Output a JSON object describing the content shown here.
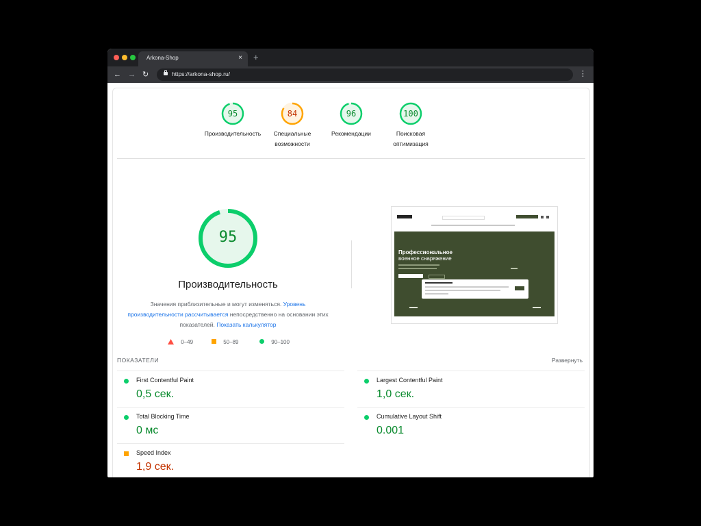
{
  "browser": {
    "tab_title": "Arkona-Shop",
    "tab_close": "×",
    "new_tab": "+",
    "url": "https://arkona-shop.ru/",
    "back": "←",
    "forward": "→",
    "reload": "↻",
    "menu": "⋮"
  },
  "scores": [
    {
      "value": "95",
      "label": "Производительность",
      "status": "good",
      "fraction": 0.95
    },
    {
      "value": "84",
      "label": "Специальные возможности",
      "status": "average",
      "fraction": 0.84
    },
    {
      "value": "96",
      "label": "Рекомендации",
      "status": "good",
      "fraction": 0.96
    },
    {
      "value": "100",
      "label": "Поисковая оптимизация",
      "status": "good",
      "fraction": 1.0
    }
  ],
  "performance": {
    "score": "95",
    "fraction": 0.95,
    "title": "Производительность",
    "desc_1": "Значения приблизительные и могут изменяться. ",
    "desc_link_1": "Уровень производительности рассчитывается",
    "desc_2": " непосредственно на основании этих показателей. ",
    "desc_link_2": "Показать калькулятор"
  },
  "legend": {
    "bad": "0–49",
    "average": "50–89",
    "good": "90–100"
  },
  "screenshot": {
    "hero_line1": "Профессиональное",
    "hero_line2": "военное снаряжение"
  },
  "metrics_section": {
    "header": "ПОКАЗАТЕЛИ",
    "expand": "Развернуть"
  },
  "metrics": [
    {
      "name": "First Contentful Paint",
      "value": "0,5 сек.",
      "status": "good"
    },
    {
      "name": "Largest Contentful Paint",
      "value": "1,0 сек.",
      "status": "good"
    },
    {
      "name": "Total Blocking Time",
      "value": "0 мс",
      "status": "good"
    },
    {
      "name": "Cumulative Layout Shift",
      "value": "0.001",
      "status": "good"
    },
    {
      "name": "Speed Index",
      "value": "1,9 сек.",
      "status": "average"
    }
  ],
  "colors": {
    "good": "#0cce6b",
    "average": "#ffa400",
    "bad": "#ff4e42",
    "good_text": "#0a8a2e",
    "average_text": "#c33300"
  }
}
